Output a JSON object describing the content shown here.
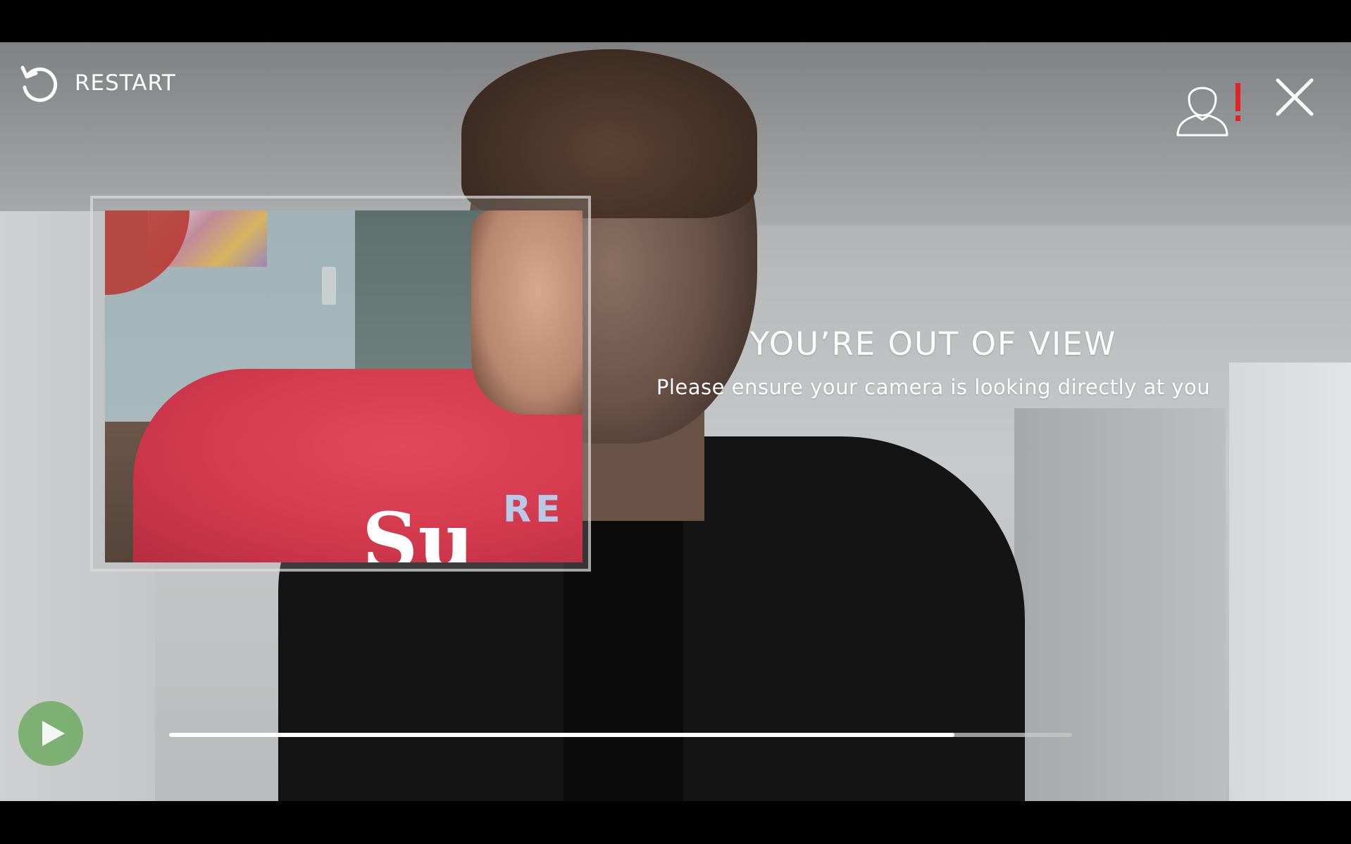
{
  "controls": {
    "restart_label": "RESTART",
    "restart_icon": "restart-icon",
    "user_alert_icon": "user-alert-icon",
    "close_icon": "close-icon",
    "play_icon": "play-icon"
  },
  "message": {
    "title": "YOU’RE OUT OF VIEW",
    "subtitle": "Please ensure your camera is looking directly at you"
  },
  "pip": {
    "shirt_text": "RE",
    "shirt_logo": "Su"
  },
  "progress": {
    "value": 0.87
  },
  "colors": {
    "alert": "#e0222a",
    "play_button": "#70aa63",
    "progress_fill": "#ffffff",
    "progress_track": "#c8c8c8"
  }
}
